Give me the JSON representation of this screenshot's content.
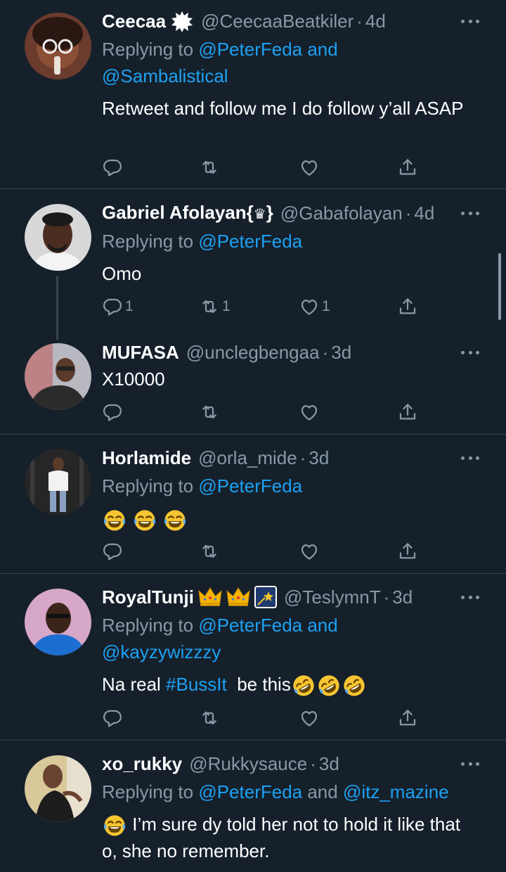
{
  "tweets": [
    {
      "name": "Ceecaa",
      "handle": "@CeecaaBeatkiler",
      "time": "4d",
      "reply_prefix": "Replying to ",
      "reply_line1": "@PeterFeda and",
      "reply_line2": "@Sambalistical",
      "text": "Retweet and follow me I do follow y’all ASAP",
      "counts": {
        "reply": "",
        "retweet": "",
        "like": ""
      }
    },
    {
      "name": "Gabriel Afolayan{",
      "name_suffix": "}",
      "handle": "@Gabafolayan",
      "time": "4d",
      "reply_prefix": "Replying to ",
      "reply_line1": "@PeterFeda",
      "text": "Omo",
      "counts": {
        "reply": "1",
        "retweet": "1",
        "like": "1"
      }
    },
    {
      "name": "MUFASA",
      "handle": "@unclegbengaa",
      "time": "3d",
      "text": "X10000",
      "counts": {
        "reply": "",
        "retweet": "",
        "like": ""
      }
    },
    {
      "name": "Horlamide",
      "handle": "@orla_mide",
      "time": "3d",
      "reply_prefix": "Replying to ",
      "reply_line1": "@PeterFeda",
      "text_emojis": [
        "laughing-tears",
        "laughing-tears",
        "laughing-tears"
      ],
      "counts": {
        "reply": "",
        "retweet": "",
        "like": ""
      }
    },
    {
      "name": "RoyalTunji",
      "handle": "@TeslymnT",
      "time": "3d",
      "reply_prefix": "Replying to ",
      "reply_line1": "@PeterFeda and",
      "reply_line2": "@kayzywizzzy",
      "text_before": "Na real ",
      "hashtag": "#BussIt",
      "text_after": "  be this",
      "counts": {
        "reply": "",
        "retweet": "",
        "like": ""
      }
    },
    {
      "name": "xo_rukky",
      "handle": "@Rukkysauce",
      "time": "3d",
      "reply_prefix": "Replying to ",
      "reply_mention1": "@PeterFeda",
      "reply_and": " and ",
      "reply_mention2": "@itz_mazine",
      "text": " I’m sure dy told her not to hold it like that o, she no remember.",
      "counts": {
        "reply": "",
        "retweet": "",
        "like": ""
      }
    }
  ],
  "separator": "·",
  "colors": {
    "background": "#15202b",
    "divider": "#38444d",
    "muted": "#8899a6",
    "link": "#1da1f2"
  },
  "icons": [
    "reply-icon",
    "retweet-icon",
    "like-icon",
    "share-icon",
    "more-icon"
  ]
}
